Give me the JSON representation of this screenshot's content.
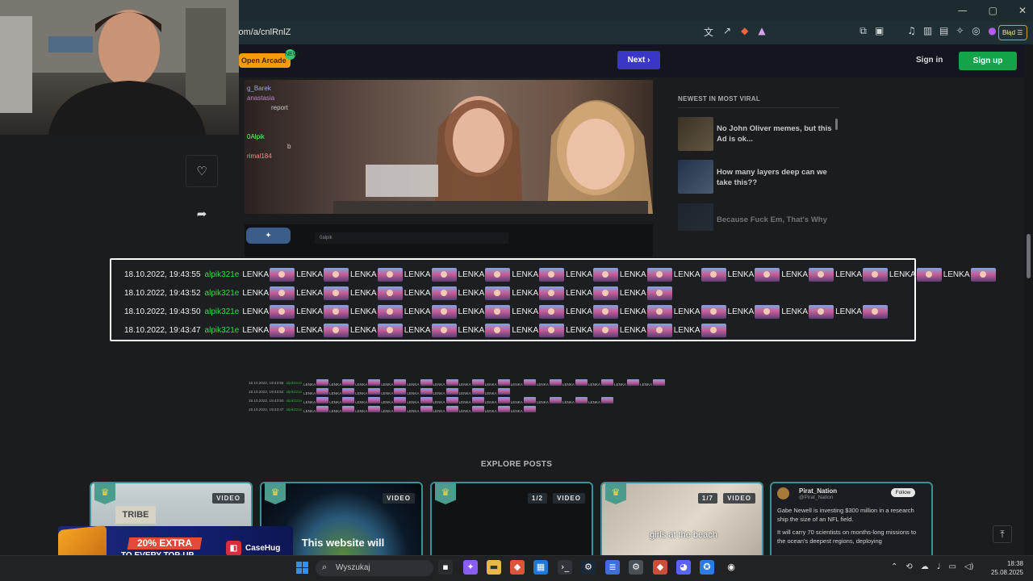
{
  "browser": {
    "address": "com/a/cnlRnlZ",
    "window_controls": [
      "—",
      "▢",
      "✕"
    ],
    "extension_button": "Błąd"
  },
  "site": {
    "open_arcade": "Open Arcade",
    "arcade_badge": "NEW",
    "next": "Next",
    "sign_in": "Sign in",
    "sign_up": "Sign up"
  },
  "post": {
    "like_icon": "heart-icon",
    "share_icon": "share-icon",
    "chat_names": [
      "g_Barek",
      "anastasia",
      "report",
      "0Alpik",
      "b",
      "rimal184"
    ],
    "search_text": "0alpik"
  },
  "sidebar": {
    "title": "NEWEST IN MOST VIRAL",
    "items": [
      {
        "text": "No John Oliver memes, but this Ad is ok..."
      },
      {
        "text": "How many layers deep can we take this??"
      },
      {
        "text": "Because Fuck Em, That's Why"
      }
    ]
  },
  "chat": {
    "emote_word": "LENKA",
    "lines": [
      {
        "time": "18.10.2022, 19:43:55",
        "user": "alpik321e",
        "count": 14
      },
      {
        "time": "18.10.2022, 19:43:52",
        "user": "alpik321e",
        "count": 8
      },
      {
        "time": "18.10.2022, 19:43:50",
        "user": "alpik321e",
        "count": 12
      },
      {
        "time": "18.10.2022, 19:43:47",
        "user": "alpik321e",
        "count": 9
      }
    ]
  },
  "explore": {
    "title": "EXPLORE POSTS",
    "cards": [
      {
        "tag": "VIDEO",
        "caption": "TRIBE",
        "counter": ""
      },
      {
        "tag": "VIDEO",
        "caption": "This website will",
        "counter": ""
      },
      {
        "tag": "VIDEO",
        "caption": "",
        "counter": "1/2"
      },
      {
        "tag": "VIDEO",
        "caption": "girls at the beach",
        "counter": "1/7"
      }
    ],
    "tweet": {
      "name": "Pirat_Nation",
      "handle": "@Pirat_Nation",
      "follow": "Follow",
      "text1": "Gabe Newell is investing $300 million in a research ship the size of an NFL field.",
      "text2": "It will carry 70 scientists on months-long missions to the ocean's deepest regions, deploying"
    }
  },
  "promo": {
    "line1": "20% EXTRA",
    "line2": "TO EVERY TOP-UP",
    "brand": "CaseHug"
  },
  "taskbar": {
    "search_placeholder": "Wyszukaj",
    "time": "18:38",
    "date": "25.08.2025"
  }
}
